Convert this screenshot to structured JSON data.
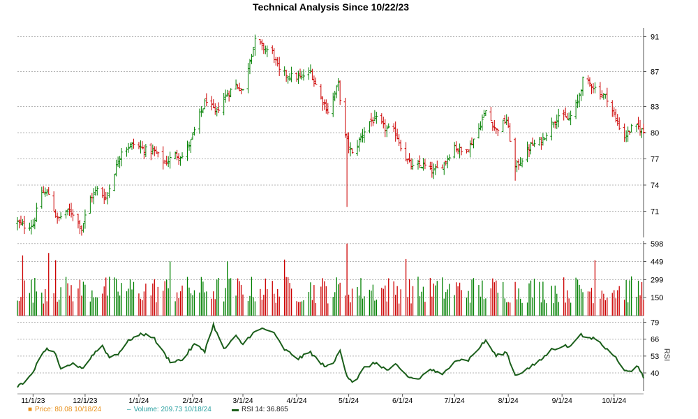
{
  "chart_data": {
    "type": "line",
    "title": "Technical Analysis Since 10/22/23",
    "price_panel": {
      "kind": "ohlc",
      "y_ticks": [
        71,
        74,
        77,
        80,
        83,
        87,
        91
      ],
      "ylim": [
        68,
        92
      ],
      "x_tick_labels": [
        "11/1/23",
        "12/1/23",
        "1/1/24",
        "2/1/24",
        "3/1/24",
        "4/1/24",
        "5/1/24",
        "6/1/24",
        "7/1/24",
        "8/1/24",
        "9/1/24",
        "10/1/24"
      ],
      "x_tick_dates": [
        "2023-11-01",
        "2023-12-01",
        "2024-01-01",
        "2024-02-01",
        "2024-03-01",
        "2024-04-01",
        "2024-05-01",
        "2024-06-01",
        "2024-07-01",
        "2024-08-01",
        "2024-09-01",
        "2024-10-01"
      ],
      "x_range": [
        "2023-10-23",
        "2024-10-18"
      ],
      "close_anchors": [
        [
          "2023-10-23",
          69.7
        ],
        [
          "2023-10-27",
          69.3
        ],
        [
          "2023-11-01",
          69.5
        ],
        [
          "2023-11-06",
          73.2
        ],
        [
          "2023-11-10",
          73.0
        ],
        [
          "2023-11-15",
          70.0
        ],
        [
          "2023-11-20",
          71.0
        ],
        [
          "2023-11-24",
          70.8
        ],
        [
          "2023-11-29",
          69.0
        ],
        [
          "2023-12-04",
          72.5
        ],
        [
          "2023-12-08",
          73.5
        ],
        [
          "2023-12-13",
          72.5
        ],
        [
          "2023-12-18",
          75.5
        ],
        [
          "2023-12-22",
          78.0
        ],
        [
          "2023-12-29",
          78.7
        ],
        [
          "2024-01-05",
          78.0
        ],
        [
          "2024-01-10",
          77.8
        ],
        [
          "2024-01-16",
          76.5
        ],
        [
          "2024-01-22",
          77.5
        ],
        [
          "2024-01-26",
          77.3
        ],
        [
          "2024-01-31",
          79.0
        ],
        [
          "2024-02-05",
          82.0
        ],
        [
          "2024-02-09",
          83.8
        ],
        [
          "2024-02-14",
          82.2
        ],
        [
          "2024-02-20",
          84.2
        ],
        [
          "2024-02-26",
          85.5
        ],
        [
          "2024-03-01",
          84.8
        ],
        [
          "2024-03-05",
          88.5
        ],
        [
          "2024-03-08",
          90.5
        ],
        [
          "2024-03-13",
          89.7
        ],
        [
          "2024-03-18",
          89.2
        ],
        [
          "2024-03-22",
          87.0
        ],
        [
          "2024-03-28",
          86.5
        ],
        [
          "2024-04-03",
          86.3
        ],
        [
          "2024-04-09",
          87.0
        ],
        [
          "2024-04-15",
          84.0
        ],
        [
          "2024-04-19",
          82.5
        ],
        [
          "2024-04-25",
          85.5
        ],
        [
          "2024-04-29",
          79.5
        ],
        [
          "2024-05-03",
          77.5
        ],
        [
          "2024-05-08",
          79.5
        ],
        [
          "2024-05-13",
          81.3
        ],
        [
          "2024-05-17",
          81.5
        ],
        [
          "2024-05-22",
          80.5
        ],
        [
          "2024-05-28",
          80.0
        ],
        [
          "2024-06-03",
          77.0
        ],
        [
          "2024-06-07",
          76.0
        ],
        [
          "2024-06-13",
          76.3
        ],
        [
          "2024-06-19",
          75.5
        ],
        [
          "2024-06-25",
          76.5
        ],
        [
          "2024-07-01",
          78.5
        ],
        [
          "2024-07-05",
          77.8
        ],
        [
          "2024-07-10",
          78.5
        ],
        [
          "2024-07-15",
          80.5
        ],
        [
          "2024-07-19",
          82.5
        ],
        [
          "2024-07-25",
          80.3
        ],
        [
          "2024-07-31",
          81.5
        ],
        [
          "2024-08-05",
          76.0
        ],
        [
          "2024-08-09",
          77.0
        ],
        [
          "2024-08-14",
          78.5
        ],
        [
          "2024-08-20",
          79.0
        ],
        [
          "2024-08-26",
          81.0
        ],
        [
          "2024-08-30",
          82.0
        ],
        [
          "2024-09-05",
          81.5
        ],
        [
          "2024-09-10",
          83.5
        ],
        [
          "2024-09-13",
          86.0
        ],
        [
          "2024-09-18",
          85.5
        ],
        [
          "2024-09-23",
          84.5
        ],
        [
          "2024-09-27",
          84.0
        ],
        [
          "2024-10-02",
          81.5
        ],
        [
          "2024-10-07",
          79.5
        ],
        [
          "2024-10-11",
          80.5
        ],
        [
          "2024-10-15",
          80.6
        ],
        [
          "2024-10-18",
          80.08
        ]
      ],
      "spike_lows": [
        [
          "2024-04-30",
          71.5
        ],
        [
          "2024-08-05",
          74.5
        ]
      ],
      "up_color": "#008000",
      "down_color": "#cc0000"
    },
    "volume_panel": {
      "y_ticks": [
        150,
        299,
        449,
        598
      ],
      "ylim": [
        0,
        620
      ],
      "typical_range": [
        100,
        330
      ],
      "spikes": [
        [
          "2023-10-26",
          500
        ],
        [
          "2023-11-10",
          520
        ],
        [
          "2023-11-14",
          460
        ],
        [
          "2024-01-19",
          450
        ],
        [
          "2024-02-21",
          450
        ],
        [
          "2024-03-25",
          465
        ],
        [
          "2024-04-30",
          598
        ],
        [
          "2024-06-03",
          470
        ],
        [
          "2024-09-20",
          460
        ]
      ]
    },
    "rsi_panel": {
      "label": "RSI",
      "y_ticks": [
        40,
        53,
        66,
        79
      ],
      "ylim": [
        26,
        82
      ],
      "anchors": [
        [
          "2023-10-23",
          30
        ],
        [
          "2023-10-28",
          32
        ],
        [
          "2023-11-03",
          46
        ],
        [
          "2023-11-08",
          58
        ],
        [
          "2023-11-13",
          57
        ],
        [
          "2023-11-17",
          42
        ],
        [
          "2023-11-23",
          47
        ],
        [
          "2023-11-30",
          44
        ],
        [
          "2023-12-06",
          55
        ],
        [
          "2023-12-11",
          61
        ],
        [
          "2023-12-15",
          52
        ],
        [
          "2023-12-20",
          55
        ],
        [
          "2023-12-27",
          66
        ],
        [
          "2024-01-03",
          70
        ],
        [
          "2024-01-09",
          68
        ],
        [
          "2024-01-15",
          56
        ],
        [
          "2024-01-19",
          49
        ],
        [
          "2024-01-26",
          50
        ],
        [
          "2024-02-02",
          62
        ],
        [
          "2024-02-08",
          57
        ],
        [
          "2024-02-13",
          77
        ],
        [
          "2024-02-19",
          58
        ],
        [
          "2024-02-26",
          68
        ],
        [
          "2024-03-01",
          62
        ],
        [
          "2024-03-06",
          70
        ],
        [
          "2024-03-12",
          74
        ],
        [
          "2024-03-18",
          72
        ],
        [
          "2024-03-25",
          58
        ],
        [
          "2024-04-02",
          51
        ],
        [
          "2024-04-09",
          56
        ],
        [
          "2024-04-15",
          47
        ],
        [
          "2024-04-21",
          44
        ],
        [
          "2024-04-26",
          58
        ],
        [
          "2024-04-30",
          38
        ],
        [
          "2024-05-04",
          32
        ],
        [
          "2024-05-10",
          44
        ],
        [
          "2024-05-17",
          48
        ],
        [
          "2024-05-23",
          42
        ],
        [
          "2024-05-28",
          46
        ],
        [
          "2024-06-04",
          37
        ],
        [
          "2024-06-10",
          35
        ],
        [
          "2024-06-17",
          43
        ],
        [
          "2024-06-24",
          38
        ],
        [
          "2024-07-01",
          50
        ],
        [
          "2024-07-09",
          50
        ],
        [
          "2024-07-15",
          59
        ],
        [
          "2024-07-19",
          65
        ],
        [
          "2024-07-25",
          53
        ],
        [
          "2024-07-31",
          56
        ],
        [
          "2024-08-05",
          38
        ],
        [
          "2024-08-12",
          43
        ],
        [
          "2024-08-19",
          49
        ],
        [
          "2024-08-26",
          58
        ],
        [
          "2024-09-02",
          61
        ],
        [
          "2024-09-06",
          60
        ],
        [
          "2024-09-11",
          70
        ],
        [
          "2024-09-16",
          66
        ],
        [
          "2024-09-20",
          67
        ],
        [
          "2024-09-26",
          59
        ],
        [
          "2024-10-02",
          53
        ],
        [
          "2024-10-07",
          41
        ],
        [
          "2024-10-11",
          42
        ],
        [
          "2024-10-15",
          45
        ],
        [
          "2024-10-18",
          36.865
        ]
      ],
      "line_color": "#1a5e1a"
    },
    "legend": [
      {
        "label": "Price: 80.08  10/18/24",
        "color": "#e8901a",
        "marker": "square"
      },
      {
        "label": "Volume: 209.73  10/18/24",
        "color": "#2aa0a0",
        "marker": "dash"
      },
      {
        "label": "RSI 14: 36.865",
        "color": "#1a5e1a",
        "marker": "line"
      }
    ]
  }
}
